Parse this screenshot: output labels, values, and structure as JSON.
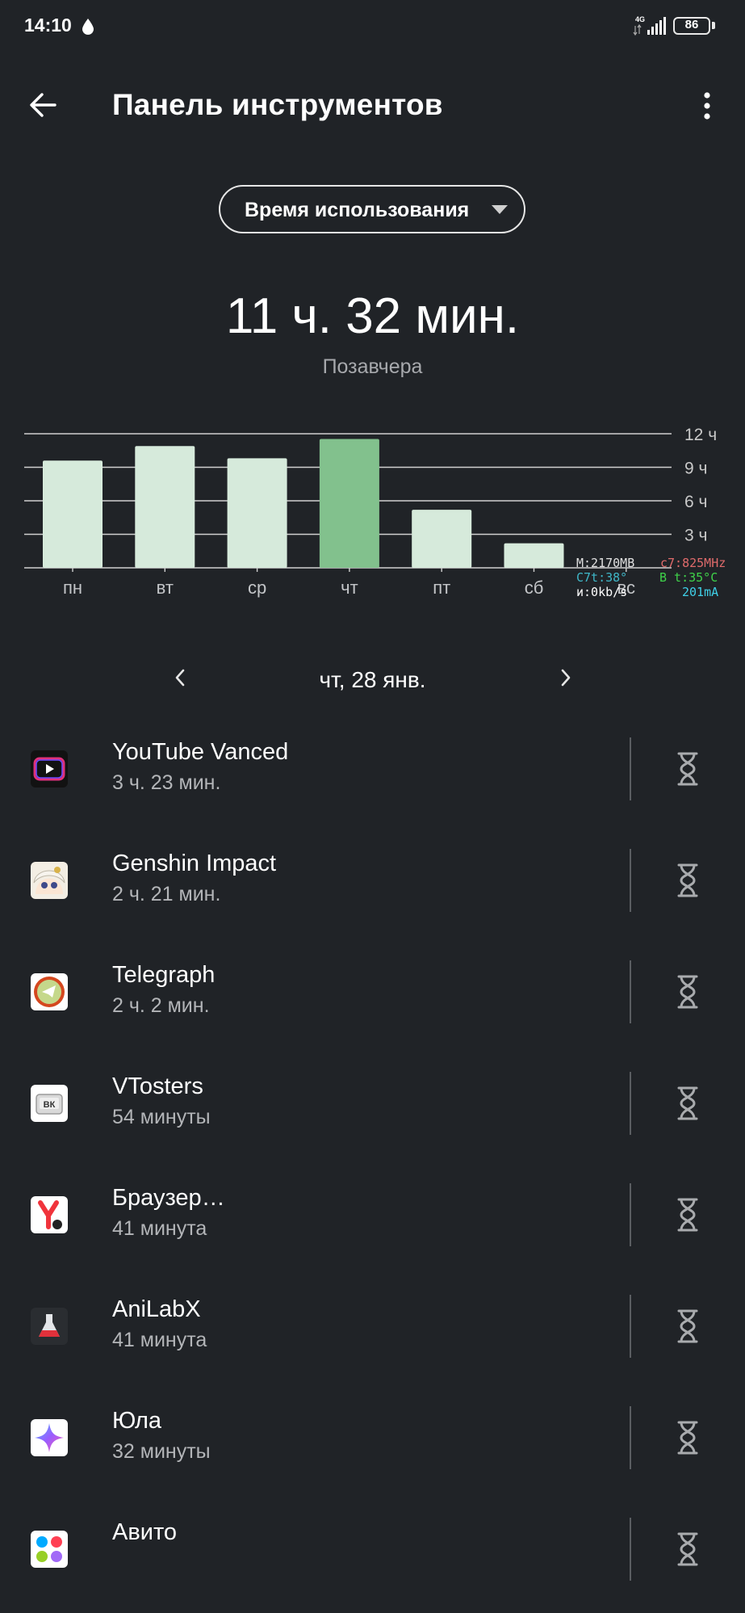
{
  "status_bar": {
    "time": "14:10",
    "network": "4G",
    "battery": "86"
  },
  "header": {
    "title": "Панель инструментов"
  },
  "metric_selector": {
    "label": "Время использования"
  },
  "summary": {
    "total": "11 ч. 32 мин.",
    "period": "Позавчера"
  },
  "chart_data": {
    "type": "bar",
    "categories": [
      "пн",
      "вт",
      "ср",
      "чт",
      "пт",
      "сб",
      "вс"
    ],
    "values": [
      9.6,
      10.9,
      9.8,
      11.53,
      5.2,
      2.2,
      0
    ],
    "selected_index": 3,
    "ylim": [
      0,
      12
    ],
    "yticks": [
      3,
      6,
      9,
      12
    ],
    "ytick_labels": [
      "3 ч",
      "6 ч",
      "9 ч",
      "12 ч"
    ],
    "grid": true,
    "colors": {
      "bar": "#d6eadb",
      "selected": "#82c18d",
      "grid": "#d0d0d0"
    }
  },
  "debug_overlay": {
    "mem": "M:2170MB",
    "cpu_freq": "c7:825MHz",
    "cpu_temp": "C7t:38°",
    "bat_temp": "B t:35°C",
    "net_speed": "и:0kb/s",
    "current": "201mA"
  },
  "date_nav": {
    "label": "чт, 28 янв."
  },
  "apps": [
    {
      "name": "YouTube Vanced",
      "time": "3 ч. 23 мин.",
      "icon": "youtube-vanced-icon"
    },
    {
      "name": "Genshin Impact",
      "time": "2 ч. 21 мин.",
      "icon": "genshin-impact-icon"
    },
    {
      "name": "Telegraph",
      "time": "2 ч. 2 мин.",
      "icon": "telegraph-icon"
    },
    {
      "name": "VTosters",
      "time": "54 минуты",
      "icon": "vtosters-icon"
    },
    {
      "name": "Браузер…",
      "time": "41 минута",
      "icon": "yandex-browser-icon"
    },
    {
      "name": "AniLabX",
      "time": "41 минута",
      "icon": "anilabx-icon"
    },
    {
      "name": "Юла",
      "time": "32 минуты",
      "icon": "yula-icon"
    },
    {
      "name": "Авито",
      "time": "",
      "icon": "avito-icon"
    }
  ]
}
